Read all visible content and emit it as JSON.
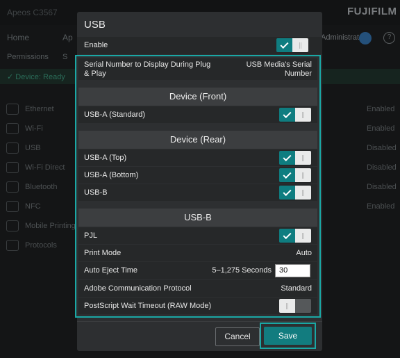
{
  "background": {
    "printer_name": "Apeos C3567",
    "brand": "FUJIFILM",
    "nav": {
      "home": "Home",
      "apps": "Ap",
      "admin": "Administrator",
      "help": "?"
    },
    "tabs": {
      "permissions": "Permissions",
      "s": "S"
    },
    "status": "✓ Device: Ready",
    "rows": [
      {
        "label": "Ethernet",
        "status": "Enabled"
      },
      {
        "label": "Wi-Fi",
        "status": "Enabled"
      },
      {
        "label": "USB",
        "status": "Disabled"
      },
      {
        "label": "Wi-Fi Direct",
        "status": "Disabled"
      },
      {
        "label": "Bluetooth",
        "status": "Disabled"
      },
      {
        "label": "NFC",
        "status": "Enabled"
      },
      {
        "label": "Mobile Printing",
        "status": ""
      },
      {
        "label": "Protocols",
        "status": ""
      }
    ]
  },
  "dialog": {
    "title": "USB",
    "enable": {
      "label": "Enable",
      "checked": true
    },
    "serial": {
      "label": "Serial Number to Display During Plug & Play",
      "value": "USB Media's Serial Number"
    },
    "device_front": {
      "heading": "Device (Front)",
      "items": [
        {
          "label": "USB-A (Standard)",
          "checked": true
        }
      ]
    },
    "device_rear": {
      "heading": "Device (Rear)",
      "items": [
        {
          "label": "USB-A (Top)",
          "checked": true
        },
        {
          "label": "USB-A (Bottom)",
          "checked": true
        },
        {
          "label": "USB-B",
          "checked": true
        }
      ]
    },
    "usb_b": {
      "heading": "USB-B",
      "pjl": {
        "label": "PJL",
        "checked": true
      },
      "print_mode": {
        "label": "Print Mode",
        "value": "Auto"
      },
      "auto_eject": {
        "label": "Auto Eject Time",
        "range": "5–1,275 Seconds",
        "value": "30"
      },
      "adobe": {
        "label": "Adobe Communication Protocol",
        "value": "Standard"
      },
      "postscript": {
        "label": "PostScript Wait Timeout (RAW Mode)",
        "checked": false
      }
    },
    "buttons": {
      "cancel": "Cancel",
      "save": "Save"
    }
  },
  "colors": {
    "accent": "#0f7d80",
    "focus_outline": "#1aa8a5",
    "dialog_bg": "#2d2f31"
  }
}
